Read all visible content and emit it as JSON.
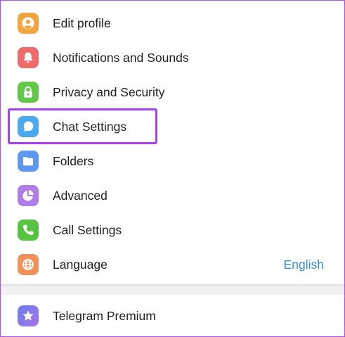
{
  "menu": {
    "items": [
      {
        "label": "Edit profile",
        "icon": "user-icon",
        "color": "#f0a53e"
      },
      {
        "label": "Notifications and Sounds",
        "icon": "bell-icon",
        "color": "#ef6a6a"
      },
      {
        "label": "Privacy and Security",
        "icon": "lock-icon",
        "color": "#62c84a"
      },
      {
        "label": "Chat Settings",
        "icon": "chat-bubble-icon",
        "color": "#4aa9f0"
      },
      {
        "label": "Folders",
        "icon": "folder-icon",
        "color": "#5e96f3"
      },
      {
        "label": "Advanced",
        "icon": "pie-chart-icon",
        "color": "#b07ce8"
      },
      {
        "label": "Call Settings",
        "icon": "phone-icon",
        "color": "#56c440"
      },
      {
        "label": "Language",
        "icon": "globe-icon",
        "color": "#f0915a",
        "value": "English"
      }
    ]
  },
  "premium": {
    "label": "Telegram Premium",
    "icon": "star-icon",
    "colors": [
      "#6a7df1",
      "#a974e6"
    ]
  },
  "colors": {
    "highlight": "#a93ff0",
    "value_text": "#3a8ed1",
    "frame_border": "#b44ee8"
  }
}
